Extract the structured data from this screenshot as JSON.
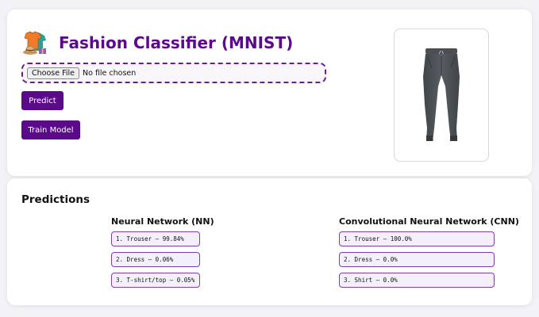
{
  "header": {
    "title": "Fashion Classifier (MNIST)",
    "logo_icon": "clothes-icon"
  },
  "file_input": {
    "button_label": "Choose File",
    "status": "No file chosen"
  },
  "buttons": {
    "predict": "Predict",
    "train": "Train Model"
  },
  "preview": {
    "icon": "trouser-image"
  },
  "predictions": {
    "title": "Predictions",
    "nn": {
      "title": "Neural Network (NN)",
      "items": [
        "1. Trouser — 99.84%",
        "2. Dress — 0.06%",
        "3. T-shirt/top — 0.05%"
      ]
    },
    "cnn": {
      "title": "Convolutional Neural Network (CNN)",
      "items": [
        "1. Trouser — 100.0%",
        "2. Dress — 0.0%",
        "3. Shirt — 0.0%"
      ]
    }
  },
  "colors": {
    "accent": "#5b0a8a",
    "border": "#7b3fa6",
    "item_bg": "#f4f0fb",
    "page_bg": "#f2f2f7"
  }
}
